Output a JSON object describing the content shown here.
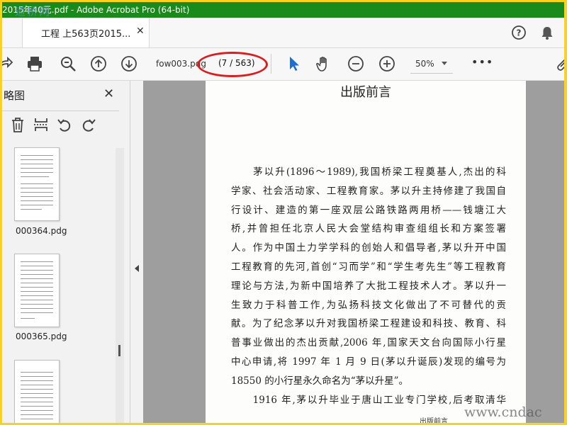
{
  "window": {
    "title": "2015年40元.pdf - Adobe Acrobat Pro (64-bit)",
    "watermark_top": "道桥网"
  },
  "tab": {
    "label": "工程 上563页2015...",
    "close_symbol": "✕"
  },
  "header_icons": [
    "help-icon",
    "bell-icon"
  ],
  "toolbar": {
    "icons_left": [
      "share-icon",
      "print-icon",
      "zoom-out-search-icon",
      "page-up-icon",
      "page-down-icon"
    ],
    "filename": "fow003.pdg",
    "page_indicator": "(7 / 563)",
    "icons_right": [
      "select-arrow-icon",
      "hand-icon",
      "zoom-out-icon",
      "zoom-in-icon"
    ],
    "zoom": "50%",
    "more": "•••"
  },
  "sidebar": {
    "title": "略图",
    "close_symbol": "✕",
    "tools": [
      "trash-icon",
      "insert-pages-icon",
      "rotate-left-icon",
      "rotate-right-icon"
    ],
    "thumbnails": [
      {
        "label": "000364.pdg"
      },
      {
        "label": "000365.pdg"
      },
      {
        "label": ""
      }
    ]
  },
  "document": {
    "title": "出版前言",
    "lines": [
      "　　茅以升(1896～1989),我国桥梁工程奠基人,杰出的科",
      "学家、社会活动家、工程教育家。茅以升主持修建了我国自",
      "行设计、建造的第一座双层公路铁路两用桥——钱塘江大",
      "桥,并曾担任北京人民大会堂结构审查组组长和方案签署",
      "人。作为中国土力学学科的创始人和倡导者,茅以升开中国",
      "工程教育的先河,首创“习而学”和“学生考先生”等工程教育",
      "理论与方法,为新中国培养了大批工程技术人才。茅以升一",
      "生致力于科普工作,为弘扬科技文化做出了不可替代的贡",
      "献。为了纪念茅以升对我国桥梁工程建设和科技、教育、科",
      "普事业做出的杰出贡献,2006 年,国家天文台向国际小行星",
      "中心申请,将 1997 年 1 月 9 日(茅以升诞辰)发现的编号为",
      "18550 的小行星永久命名为“茅以升星”。",
      "　　1916 年,茅以升毕业于唐山工业专门学校,后考取清华"
    ],
    "footer": "出版前言",
    "watermark_bottom": "www.cndac"
  },
  "colors": {
    "titlebar": "#1a8a1a",
    "border": "#ffd21a",
    "annotation_oval": "#d81e1e",
    "select_arrow": "#1f6fd1"
  }
}
